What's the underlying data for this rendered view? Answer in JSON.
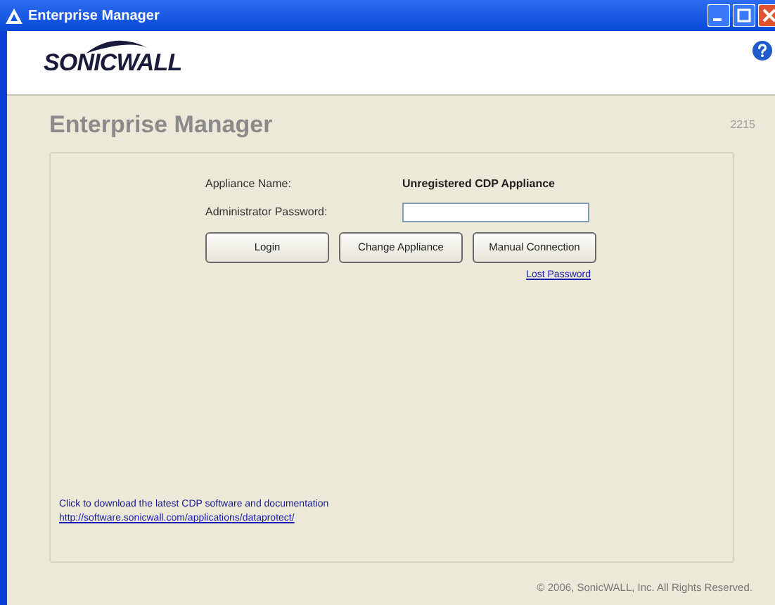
{
  "window": {
    "title": "Enterprise Manager"
  },
  "header": {
    "logo": "SONICWALL"
  },
  "page": {
    "title": "Enterprise Manager",
    "version": "2215"
  },
  "form": {
    "appliance_label": "Appliance Name:",
    "appliance_value": "Unregistered CDP Appliance",
    "password_label": "Administrator Password:"
  },
  "buttons": [
    "Login",
    "Change Appliance",
    "Manual Connection"
  ],
  "lost_password": "Lost Password",
  "download": {
    "text": "Click to download the latest CDP software and documentation",
    "link": "http://software.sonicwall.com/applications/dataprotect/"
  },
  "footer": "© 2006, SonicWALL, Inc. All Rights Reserved."
}
